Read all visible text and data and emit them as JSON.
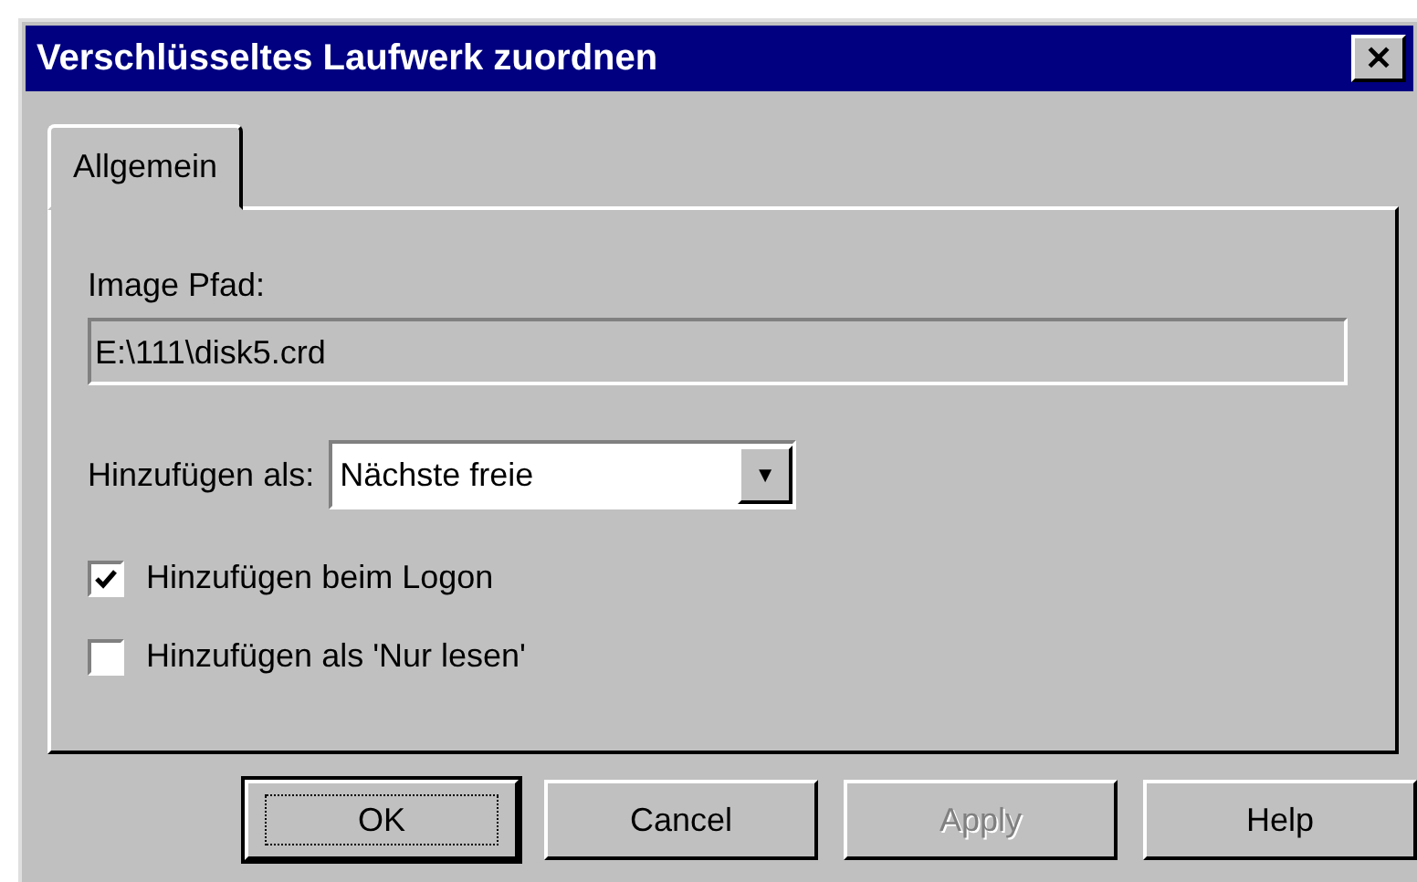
{
  "window": {
    "title": "Verschlüsseltes Laufwerk zuordnen",
    "close": "✕"
  },
  "tabs": [
    {
      "label": "Allgemein",
      "selected": true
    }
  ],
  "image_path": {
    "label": "Image Pfad:",
    "value": "E:\\111\\disk5.crd",
    "disabled": true
  },
  "add_as": {
    "label": "Hinzufügen als:",
    "value": "Nächste freie",
    "arrow": "▼"
  },
  "checkboxes": [
    {
      "label": "Hinzufügen beim Logon",
      "checked": true
    },
    {
      "label": "Hinzufügen als 'Nur lesen'",
      "checked": false
    }
  ],
  "buttons": [
    {
      "label": "OK",
      "default": true,
      "disabled": false
    },
    {
      "label": "Cancel",
      "default": false,
      "disabled": false
    },
    {
      "label": "Apply",
      "default": false,
      "disabled": true
    },
    {
      "label": "Help",
      "default": false,
      "disabled": false
    }
  ]
}
